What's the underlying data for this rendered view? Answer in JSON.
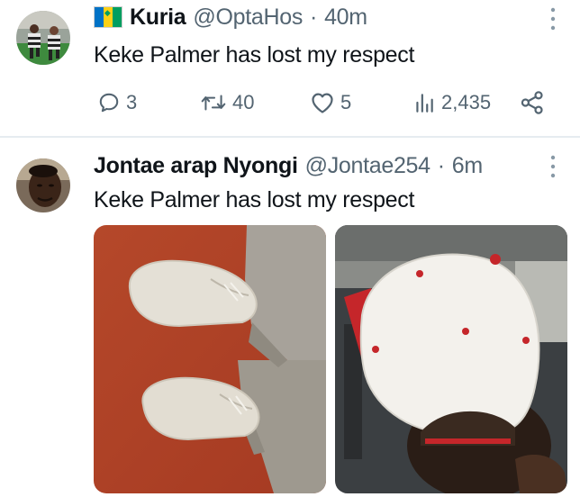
{
  "tweets": [
    {
      "display_name": "Kuria",
      "handle": "@OptaHos",
      "separator": "·",
      "time": "40m",
      "text": "Keke Palmer has lost my respect",
      "flag_icon": "flag-icon",
      "stats": {
        "replies": "3",
        "retweets": "40",
        "likes": "5",
        "views": "2,435"
      }
    },
    {
      "display_name": "Jontae arap Nyongi",
      "handle": "@Jontae254",
      "separator": "·",
      "time": "6m",
      "text": "Keke Palmer has lost my respect"
    }
  ],
  "icons": {
    "reply": "reply-icon",
    "retweet": "retweet-icon",
    "like": "heart-icon",
    "views": "views-icon",
    "share": "share-icon",
    "more": "more-icon"
  },
  "colors": {
    "text": "#0f1419",
    "secondary": "#536471",
    "divider": "#e6ecf0"
  }
}
